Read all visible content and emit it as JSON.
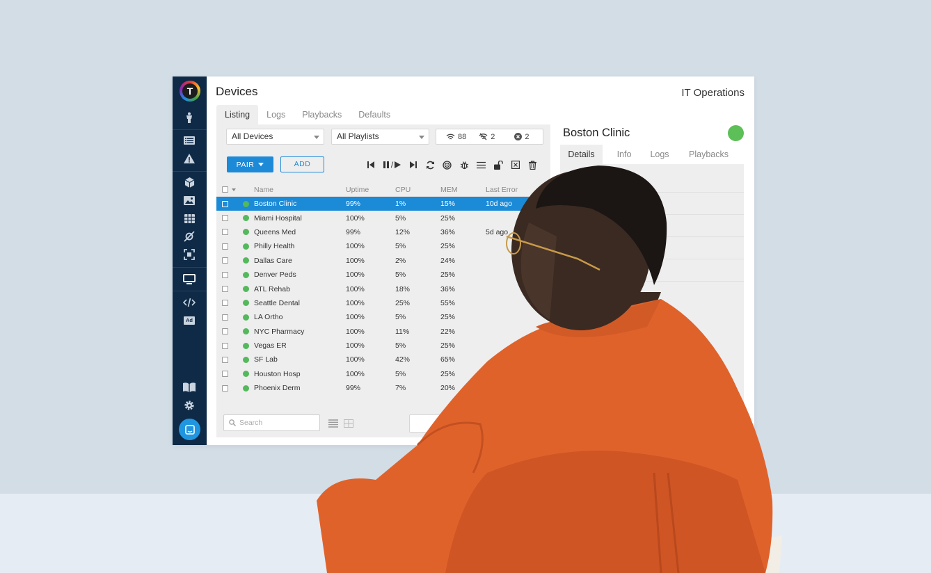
{
  "app": {
    "logo_letter": "T",
    "page_title": "Devices",
    "org_name": "IT Operations"
  },
  "sidebar": {
    "items": [
      {
        "icon": "person-icon"
      },
      {
        "icon": "list-icon"
      },
      {
        "icon": "warning-icon"
      },
      {
        "icon": "cube-icon"
      },
      {
        "icon": "image-icon"
      },
      {
        "icon": "grid-icon"
      },
      {
        "icon": "satellite-icon"
      },
      {
        "icon": "scan-icon"
      },
      {
        "icon": "monitor-icon"
      },
      {
        "icon": "code-icon"
      },
      {
        "icon": "ad-icon"
      },
      {
        "icon": "book-icon"
      },
      {
        "icon": "gear-icon"
      },
      {
        "icon": "chat-icon"
      }
    ],
    "ad_label": "Ad"
  },
  "tabs": [
    "Listing",
    "Logs",
    "Playbacks",
    "Defaults"
  ],
  "filters": {
    "devices": "All Devices",
    "playlists": "All Playlists"
  },
  "stats": {
    "online": "88",
    "offline": "2",
    "errors": "2"
  },
  "actions": {
    "pair": "PAIR",
    "add": "ADD",
    "pause_sep": "/"
  },
  "table": {
    "headers": {
      "name": "Name",
      "uptime": "Uptime",
      "cpu": "CPU",
      "mem": "MEM",
      "last_error": "Last Error"
    },
    "rows": [
      {
        "name": "Boston Clinic",
        "uptime": "99%",
        "cpu": "1%",
        "mem": "15%",
        "err": "10d ago"
      },
      {
        "name": "Miami Hospital",
        "uptime": "100%",
        "cpu": "5%",
        "mem": "25%",
        "err": ""
      },
      {
        "name": "Queens Med",
        "uptime": "99%",
        "cpu": "12%",
        "mem": "36%",
        "err": "5d ago"
      },
      {
        "name": "Philly Health",
        "uptime": "100%",
        "cpu": "5%",
        "mem": "25%",
        "err": ""
      },
      {
        "name": "Dallas Care",
        "uptime": "100%",
        "cpu": "2%",
        "mem": "24%",
        "err": ""
      },
      {
        "name": "Denver Peds",
        "uptime": "100%",
        "cpu": "5%",
        "mem": "25%",
        "err": ""
      },
      {
        "name": "ATL Rehab",
        "uptime": "100%",
        "cpu": "18%",
        "mem": "36%",
        "err": ""
      },
      {
        "name": "Seattle Dental",
        "uptime": "100%",
        "cpu": "25%",
        "mem": "55%",
        "err": ""
      },
      {
        "name": "LA Ortho",
        "uptime": "100%",
        "cpu": "5%",
        "mem": "25%",
        "err": ""
      },
      {
        "name": "NYC Pharmacy",
        "uptime": "100%",
        "cpu": "11%",
        "mem": "22%",
        "err": ""
      },
      {
        "name": "Vegas ER",
        "uptime": "100%",
        "cpu": "5%",
        "mem": "25%",
        "err": ""
      },
      {
        "name": "SF Lab",
        "uptime": "100%",
        "cpu": "42%",
        "mem": "65%",
        "err": ""
      },
      {
        "name": "Houston Hosp",
        "uptime": "100%",
        "cpu": "5%",
        "mem": "25%",
        "err": ""
      },
      {
        "name": "Phoenix Derm",
        "uptime": "99%",
        "cpu": "7%",
        "mem": "20%",
        "err": ""
      }
    ]
  },
  "search": {
    "placeholder": "Search"
  },
  "detail": {
    "title": "Boston Clinic",
    "status_color": "#5cbf57",
    "tabs": [
      "Details",
      "Info",
      "Logs",
      "Playbacks"
    ]
  },
  "colors": {
    "sidebar": "#0f2a47",
    "accent": "#1d8ad8",
    "online": "#54b85c",
    "jacket": "#e0622b"
  }
}
